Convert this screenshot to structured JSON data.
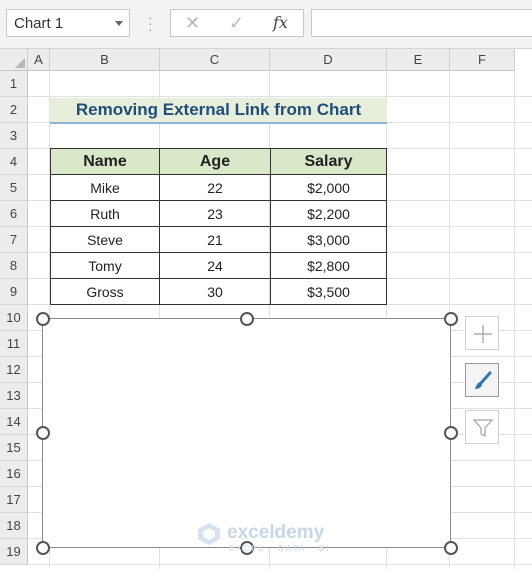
{
  "formula_bar": {
    "name_box": "Chart 1",
    "cancel_glyph": "✕",
    "enter_glyph": "✓",
    "fx_label": "fx",
    "formula": ""
  },
  "columns": [
    "A",
    "B",
    "C",
    "D",
    "E",
    "F"
  ],
  "rows": [
    "1",
    "2",
    "3",
    "4",
    "5",
    "6",
    "7",
    "8",
    "9",
    "10",
    "11",
    "12",
    "13",
    "14",
    "15",
    "16",
    "17",
    "18",
    "19"
  ],
  "title": "Removing External Link from Chart",
  "table": {
    "headers": [
      "Name",
      "Age",
      "Salary"
    ],
    "rows": [
      [
        "Mike",
        "22",
        "$2,000"
      ],
      [
        "Ruth",
        "23",
        "$2,200"
      ],
      [
        "Steve",
        "21",
        "$3,000"
      ],
      [
        "Tomy",
        "24",
        "$2,800"
      ],
      [
        "Gross",
        "30",
        "$3,500"
      ]
    ]
  },
  "chart_buttons": {
    "elements": "plus-icon",
    "styles": "brush-icon",
    "filters": "funnel-icon"
  },
  "watermark": {
    "name": "exceldemy",
    "tagline": "EXCEL · DATA · BI"
  },
  "colors": {
    "title_text": "#1f4e79",
    "title_fill": "#e8eedc",
    "header_fill": "#d9e8c8"
  }
}
